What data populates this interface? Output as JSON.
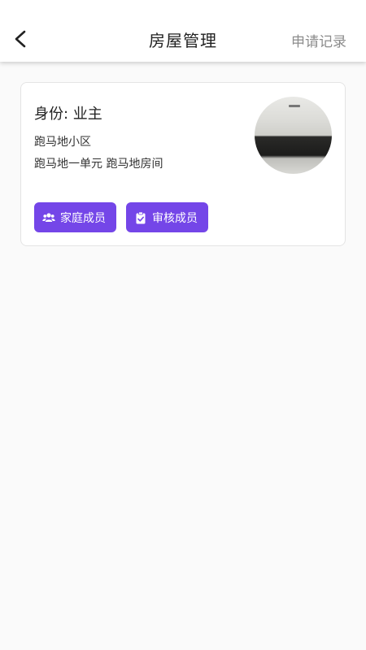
{
  "header": {
    "title": "房屋管理",
    "records_label": "申请记录",
    "back_icon": "chevron-left-icon"
  },
  "card": {
    "identity": "身份: 业主",
    "community": "跑马地小区",
    "address": "跑马地一单元 跑马地房间",
    "buttons": [
      {
        "label": "家庭成员",
        "icon": "users-icon"
      },
      {
        "label": "审核成员",
        "icon": "clipboard-check-icon"
      }
    ]
  },
  "colors": {
    "accent": "#7446e8",
    "background": "#fafafa",
    "link_gray": "#8c8c8c"
  }
}
